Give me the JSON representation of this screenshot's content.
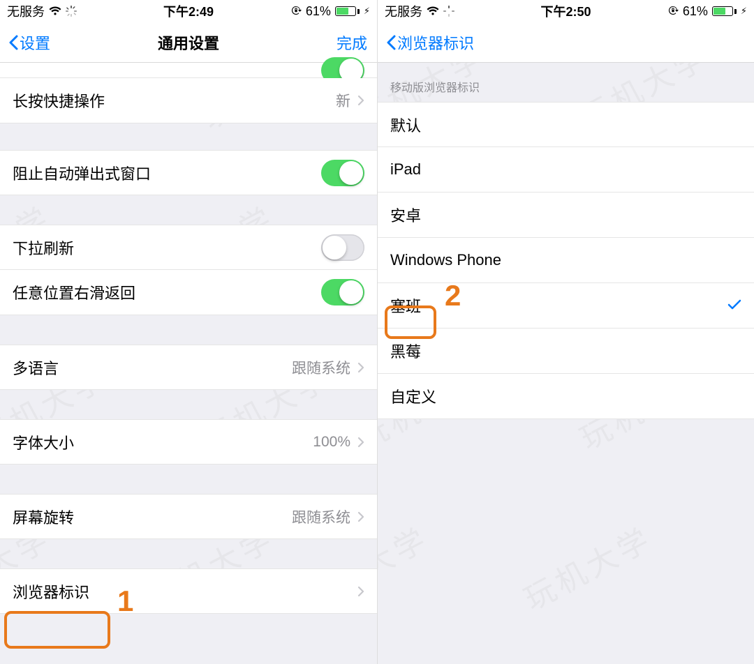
{
  "watermark": "玩机大学",
  "left": {
    "status": {
      "carrier": "无服务",
      "time": "下午2:49",
      "battery": "61%"
    },
    "nav": {
      "back": "设置",
      "title": "通用设置",
      "right": "完成"
    },
    "rows": {
      "longpress": {
        "label": "长按快捷操作",
        "value": "新"
      },
      "popup": {
        "label": "阻止自动弹出式窗口"
      },
      "pullrefresh": {
        "label": "下拉刷新"
      },
      "swipeback": {
        "label": "任意位置右滑返回"
      },
      "language": {
        "label": "多语言",
        "value": "跟随系统"
      },
      "fontsize": {
        "label": "字体大小",
        "value": "100%"
      },
      "rotation": {
        "label": "屏幕旋转",
        "value": "跟随系统"
      },
      "ua": {
        "label": "浏览器标识"
      }
    },
    "annotation": "1"
  },
  "right": {
    "status": {
      "carrier": "无服务",
      "time": "下午2:50",
      "battery": "61%"
    },
    "nav": {
      "back": "浏览器标识"
    },
    "section_header": "移动版浏览器标识",
    "options": {
      "default": "默认",
      "ipad": "iPad",
      "android": "安卓",
      "wp": "Windows Phone",
      "symbian": "塞班",
      "blackberry": "黑莓",
      "custom": "自定义"
    },
    "annotation": "2"
  }
}
